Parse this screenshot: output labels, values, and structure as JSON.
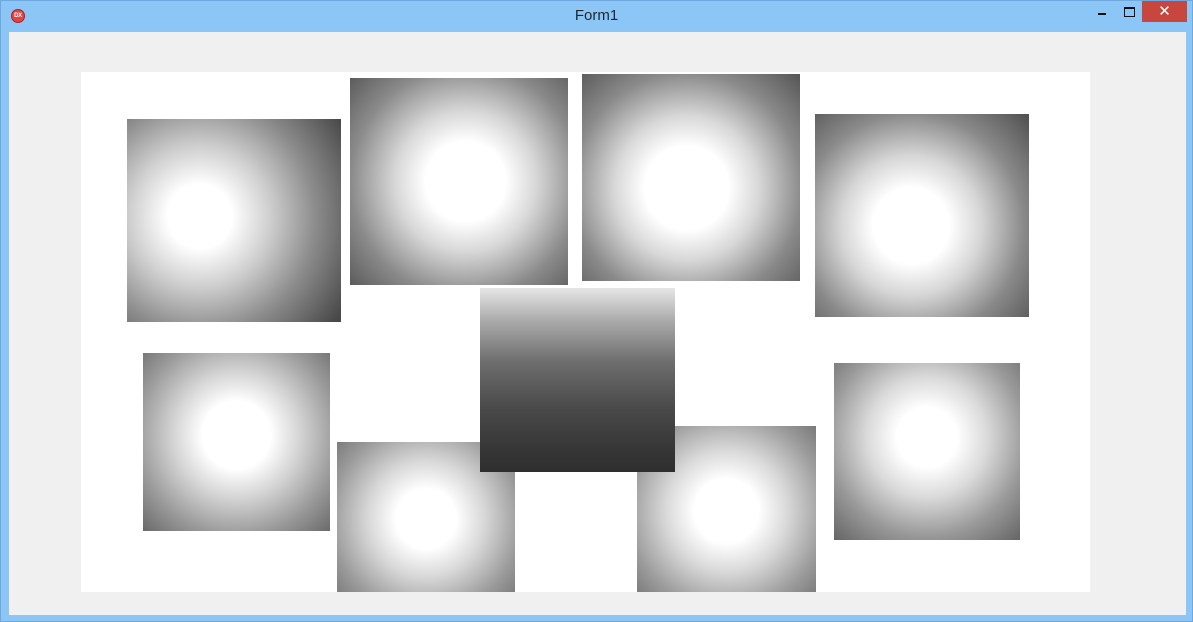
{
  "window": {
    "title": "Form1",
    "icon": "dx-app-icon",
    "controls": [
      "minimize-icon",
      "maximize-icon",
      "close-icon"
    ],
    "close_glyph": "✕"
  },
  "canvas": {
    "background": "#ffffff",
    "tiles": [
      {
        "name": "gradient-tile-1",
        "kind": "radial"
      },
      {
        "name": "gradient-tile-2",
        "kind": "radial"
      },
      {
        "name": "gradient-tile-3",
        "kind": "radial"
      },
      {
        "name": "gradient-tile-4",
        "kind": "radial"
      },
      {
        "name": "gradient-tile-5",
        "kind": "radial"
      },
      {
        "name": "gradient-tile-6",
        "kind": "radial"
      },
      {
        "name": "gradient-tile-7",
        "kind": "radial"
      },
      {
        "name": "gradient-tile-8",
        "kind": "radial"
      },
      {
        "name": "gradient-tile-9",
        "kind": "linear"
      }
    ]
  },
  "colors": {
    "titlebar": "#8cc6f7",
    "client": "#f0f0f0",
    "close_button": "#c7463d"
  }
}
